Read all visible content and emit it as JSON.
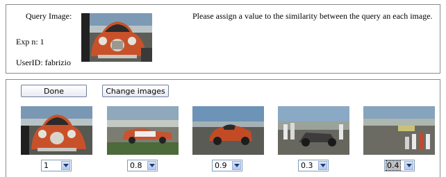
{
  "query": {
    "label": "Query Image:",
    "exp": "Exp n: 1",
    "user": "UserID: fabrizio",
    "instructions": "Please assign a value to the similarity between the query an each image."
  },
  "toolbar": {
    "done_label": "Done",
    "change_label": "Change  images"
  },
  "results": [
    {
      "score": "1",
      "thumb_icon": "red-vintage-car-front-view"
    },
    {
      "score": "0.8",
      "thumb_icon": "red-white-sedan-side-view"
    },
    {
      "score": "0.9",
      "thumb_icon": "red-car-racing-side-view"
    },
    {
      "score": "0.3",
      "thumb_icon": "dragster-with-crowd"
    },
    {
      "score": "0.4",
      "thumb_icon": "drag-strip-spectators"
    }
  ]
}
